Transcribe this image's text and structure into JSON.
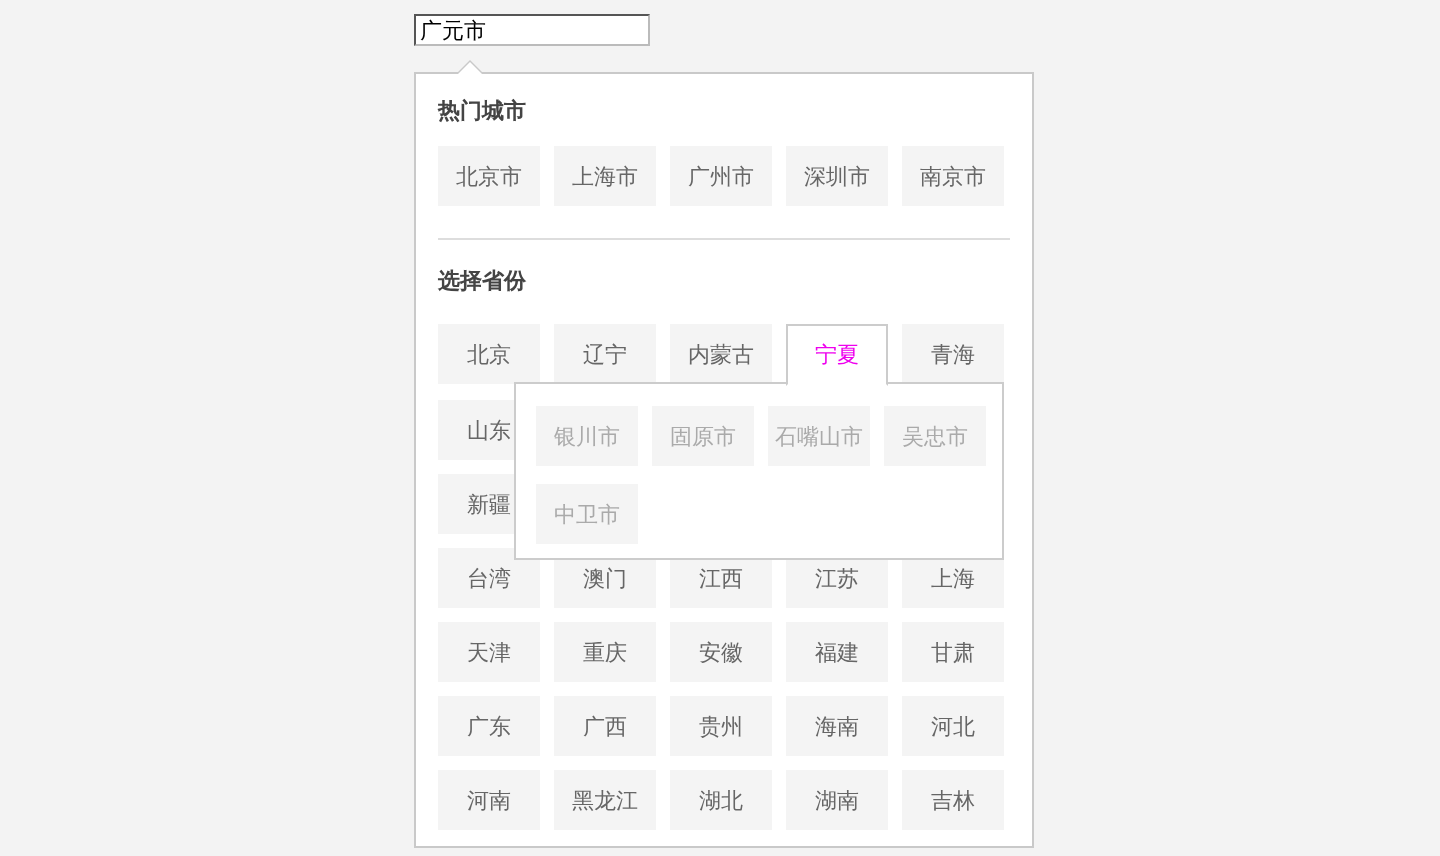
{
  "search_field": {
    "value": "广元市"
  },
  "hot_cities": {
    "title": "热门城市",
    "items": [
      "北京市",
      "上海市",
      "广州市",
      "深圳市",
      "南京市"
    ]
  },
  "provinces": {
    "title": "选择省份",
    "rows": [
      [
        {
          "label": "北京",
          "selected": false
        },
        {
          "label": "辽宁",
          "selected": false
        },
        {
          "label": "内蒙古",
          "selected": false
        },
        {
          "label": "宁夏",
          "selected": true
        },
        {
          "label": "青海",
          "selected": false
        }
      ],
      [
        {
          "label": "山东",
          "selected": false
        }
      ],
      [
        {
          "label": "新疆",
          "selected": false
        }
      ],
      [
        {
          "label": "台湾",
          "selected": false
        },
        {
          "label": "澳门",
          "selected": false
        },
        {
          "label": "江西",
          "selected": false
        },
        {
          "label": "江苏",
          "selected": false
        },
        {
          "label": "上海",
          "selected": false
        }
      ],
      [
        {
          "label": "天津",
          "selected": false
        },
        {
          "label": "重庆",
          "selected": false
        },
        {
          "label": "安徽",
          "selected": false
        },
        {
          "label": "福建",
          "selected": false
        },
        {
          "label": "甘肃",
          "selected": false
        }
      ],
      [
        {
          "label": "广东",
          "selected": false
        },
        {
          "label": "广西",
          "selected": false
        },
        {
          "label": "贵州",
          "selected": false
        },
        {
          "label": "海南",
          "selected": false
        },
        {
          "label": "河北",
          "selected": false
        }
      ],
      [
        {
          "label": "河南",
          "selected": false
        },
        {
          "label": "黑龙江",
          "selected": false
        },
        {
          "label": "湖北",
          "selected": false
        },
        {
          "label": "湖南",
          "selected": false
        },
        {
          "label": "吉林",
          "selected": false
        }
      ]
    ]
  },
  "popup": {
    "cities": [
      "银川市",
      "固原市",
      "石嘴山市",
      "吴忠市",
      "中卫市"
    ]
  }
}
